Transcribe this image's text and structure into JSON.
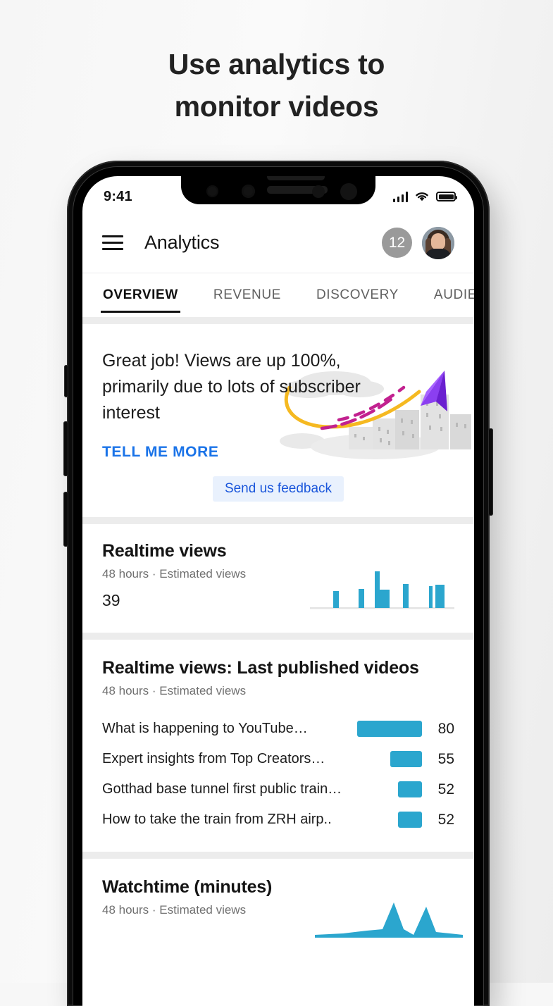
{
  "headline": {
    "line1": "Use analytics to",
    "line2": "monitor videos"
  },
  "status_bar": {
    "time": "9:41",
    "signal_icon": "cellular-signal-icon",
    "wifi_icon": "wifi-icon",
    "battery_icon": "battery-icon"
  },
  "app_bar": {
    "menu_icon": "hamburger-menu-icon",
    "title": "Analytics",
    "notification_count": "12",
    "avatar_icon": "user-avatar"
  },
  "tabs": [
    {
      "label": "OVERVIEW",
      "active": true
    },
    {
      "label": "REVENUE",
      "active": false
    },
    {
      "label": "DISCOVERY",
      "active": false
    },
    {
      "label": "AUDIENCE",
      "active": false
    }
  ],
  "hero": {
    "message": "Great job! Views are up 100%, primarily due to lots of subscriber interest",
    "cta_label": "TELL ME MORE",
    "illustration": "paper-plane-city-illustration",
    "colors": {
      "plane_light": "#8b3ff0",
      "plane_dark": "#6a1fd0",
      "trail_yellow": "#f5b921",
      "trail_magenta": "#c2218f",
      "cloud": "#e6e6e6",
      "building": "#e0e0e0"
    }
  },
  "feedback": {
    "label": "Send us feedback",
    "color": "#1a56db",
    "background": "#e9f1fd"
  },
  "realtime_views": {
    "title": "Realtime views",
    "subtitle": "48 hours · Estimated views",
    "value": "39"
  },
  "last_published": {
    "title": "Realtime views: Last published videos",
    "subtitle": "48 hours · Estimated views",
    "rows": [
      {
        "name": "What is happening to YouTube…",
        "value": "80"
      },
      {
        "name": "Expert insights from Top Creators…",
        "value": "55"
      },
      {
        "name": "Gotthad base tunnel first public train…",
        "value": "52"
      },
      {
        "name": "How to take the train from ZRH airp..",
        "value": "52"
      }
    ]
  },
  "watchtime": {
    "title": "Watchtime (minutes)",
    "subtitle": "48 hours · Estimated views"
  },
  "chart_data": [
    {
      "type": "bar",
      "title": "Realtime views",
      "name": "realtime-views-sparkline",
      "categories": [
        "1",
        "2",
        "3",
        "4",
        "5",
        "6",
        "7"
      ],
      "values": [
        0,
        46,
        0,
        52,
        100,
        8,
        62,
        0,
        55,
        58
      ],
      "bar_color": "#2ba6ce",
      "baseline_color": "#e3e3e3",
      "xlabel": "",
      "ylabel": "",
      "ylim": [
        0,
        100
      ],
      "grid": false,
      "legend": false
    },
    {
      "type": "bar",
      "title": "Realtime views: Last published videos",
      "name": "last-published-bars",
      "orientation": "horizontal",
      "categories": [
        "What is happening to YouTube…",
        "Expert insights from Top Creators…",
        "Gotthad base tunnel first public train…",
        "How to take the train from ZRH airp.."
      ],
      "values": [
        80,
        55,
        52,
        52
      ],
      "bar_color": "#2ba6ce",
      "xlabel": "",
      "ylabel": "",
      "xlim": [
        0,
        80
      ],
      "grid": false,
      "legend": false
    },
    {
      "type": "area",
      "title": "Watchtime (minutes)",
      "name": "watchtime-area-chart",
      "x": [
        0,
        1,
        2,
        3,
        4,
        5,
        6,
        7,
        8
      ],
      "values": [
        18,
        20,
        22,
        24,
        90,
        20,
        8,
        70,
        10
      ],
      "fill_color": "#2ba6ce",
      "xlabel": "",
      "ylabel": "",
      "ylim": [
        0,
        100
      ],
      "grid": false,
      "legend": false
    }
  ]
}
